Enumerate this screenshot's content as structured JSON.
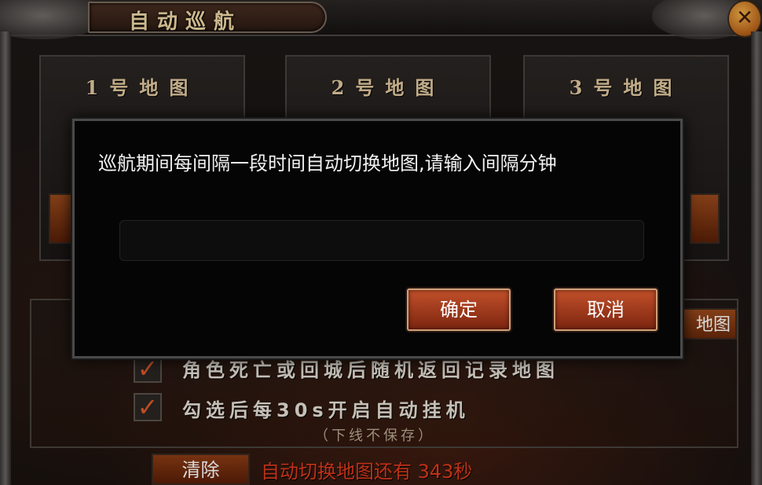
{
  "window": {
    "title": "自动巡航",
    "close_icon": "close-icon"
  },
  "maps": [
    {
      "title": "1号地图",
      "line2": ""
    },
    {
      "title": "2号地图",
      "line2": ""
    },
    {
      "title": "3号地图",
      "line2": ""
    }
  ],
  "options": [
    {
      "label": "角色死亡或回城后随机返回记录地图",
      "checked": true
    },
    {
      "label": "勾选后每30s开启自动挂机",
      "checked": true
    }
  ],
  "options_note": "（下线不保存）",
  "right_tab_label": "地图",
  "clear_button": "清除",
  "status": "自动切换地图还有 343秒",
  "dialog": {
    "prompt": "巡航期间每间隔一段时间自动切换地图,请输入间隔分钟",
    "input_value": "",
    "confirm": "确定",
    "cancel": "取消"
  },
  "colors": {
    "accent": "#c2502a",
    "status": "#e23a1c",
    "title": "#f0d9a6"
  }
}
